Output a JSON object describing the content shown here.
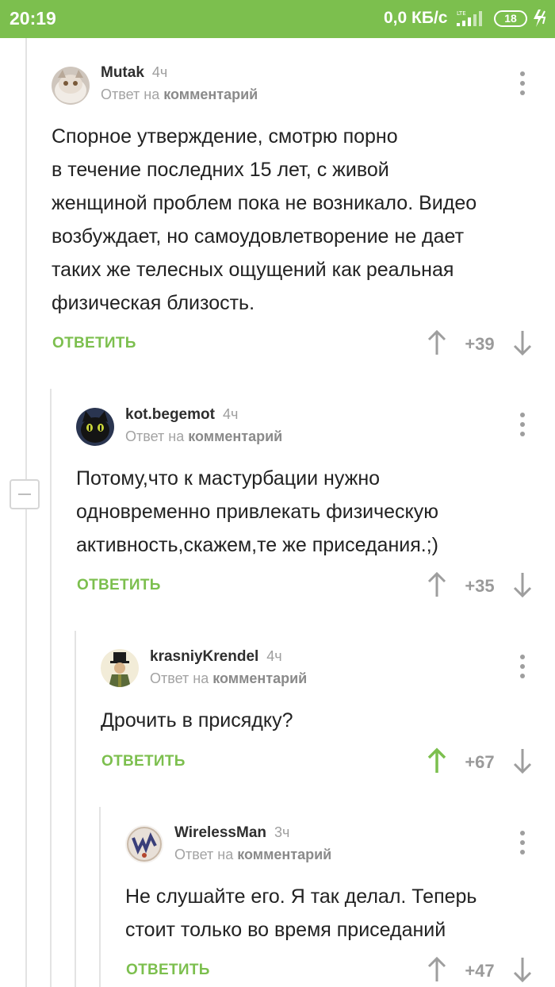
{
  "status_bar": {
    "time": "20:19",
    "speed": "0,0 КБ/с",
    "network": "LTE",
    "battery": "18",
    "accent_color": "#7cbf4e"
  },
  "comments": [
    {
      "author": "Mutak",
      "age": "4ч",
      "meta_prefix": "Ответ на",
      "meta_link": "комментарий",
      "lines": [
        "Спорное утверждение, смотрю порно",
        "в течение последних 15 лет, с живой",
        "женщиной проблем пока не возникало. Видео",
        "возбуждает, но самоудовлетворение не дает",
        "таких же телесных ощущений как реальная",
        "физическая близость."
      ],
      "reply": "ОТВЕТИТЬ",
      "score": "+39",
      "upvoted": false
    },
    {
      "author": "kot.begemot",
      "age": "4ч",
      "meta_prefix": "Ответ на",
      "meta_link": "комментарий",
      "lines": [
        "Потому,что к мастурбации нужно",
        "одновременно привлекать физическую",
        "активность,скажем,те же приседания.;)"
      ],
      "reply": "ОТВЕТИТЬ",
      "score": "+35",
      "upvoted": false
    },
    {
      "author": "krasniyKrendel",
      "age": "4ч",
      "meta_prefix": "Ответ на",
      "meta_link": "комментарий",
      "lines": [
        "Дрочить в присядку?"
      ],
      "reply": "ОТВЕТИТЬ",
      "score": "+67",
      "upvoted": true
    },
    {
      "author": "WirelessMan",
      "age": "3ч",
      "meta_prefix": "Ответ на",
      "meta_link": "комментарий",
      "lines": [
        "Не слушайте его. Я так делал. Теперь",
        "стоит только во время приседаний"
      ],
      "reply": "ОТВЕТИТЬ",
      "score": "+47",
      "upvoted": false
    }
  ]
}
